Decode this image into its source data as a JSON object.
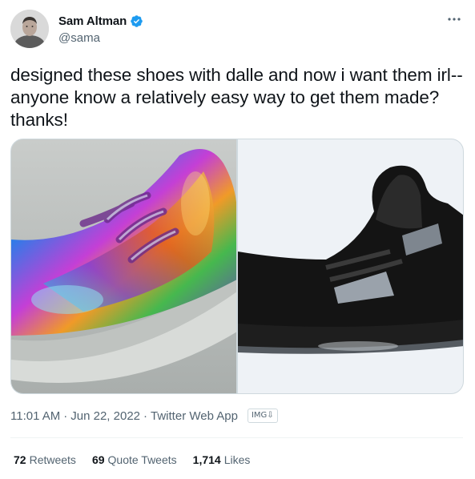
{
  "author": {
    "display_name": "Sam Altman",
    "handle": "@sama",
    "verified": true,
    "avatar_icon": "profile-photo"
  },
  "tweet": {
    "text": "designed these shoes with dalle and now i want them irl--anyone know a relatively easy way to get them made? thanks!",
    "media": [
      {
        "icon": "iridescent-sneaker-image"
      },
      {
        "icon": "black-sneaker-image"
      }
    ]
  },
  "meta": {
    "time": "11:01 AM",
    "separator": "·",
    "date": "Jun 22, 2022",
    "source": "Twitter Web App",
    "badge": "IMG⇩"
  },
  "stats": [
    {
      "value": "72",
      "label": "Retweets"
    },
    {
      "value": "69",
      "label": "Quote Tweets"
    },
    {
      "value": "1,714",
      "label": "Likes"
    }
  ],
  "colors": {
    "text": "#0f1419",
    "secondary": "#536471",
    "verified": "#1d9bf0",
    "border": "#cfd9de"
  }
}
